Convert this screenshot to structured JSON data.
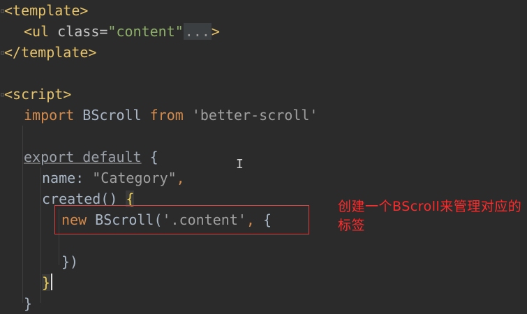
{
  "editor": {
    "lines": [
      {
        "id": "l1",
        "parts": [
          {
            "cls": "tag",
            "t": "<template>"
          }
        ]
      },
      {
        "id": "l2",
        "parts": [
          {
            "cls": "tag",
            "t": "<ul "
          },
          {
            "cls": "attr",
            "t": "class="
          },
          {
            "cls": "str",
            "t": "\"content\""
          },
          {
            "cls": "fold-ellipsis",
            "t": "..."
          },
          {
            "cls": "tag",
            "t": ">"
          }
        ]
      },
      {
        "id": "l3",
        "parts": [
          {
            "cls": "tag",
            "t": "</template>"
          }
        ]
      },
      {
        "id": "l4",
        "parts": []
      },
      {
        "id": "l5",
        "parts": [
          {
            "cls": "tag",
            "t": "<script>"
          }
        ]
      },
      {
        "id": "l6",
        "parts": [
          {
            "cls": "kw",
            "t": "import"
          },
          {
            "cls": "prop",
            "t": " BScroll "
          },
          {
            "cls": "kw",
            "t": "from"
          },
          {
            "cls": "str-gray",
            "t": " 'better-scroll'"
          }
        ]
      },
      {
        "id": "l7",
        "parts": []
      },
      {
        "id": "l8",
        "parts": [
          {
            "cls": "kw-gray",
            "t": "export default"
          },
          {
            "cls": "prop",
            "t": " {"
          }
        ]
      },
      {
        "id": "l9",
        "parts": [
          {
            "cls": "prop",
            "t": "name: "
          },
          {
            "cls": "str-gray",
            "t": "\"Category\""
          },
          {
            "cls": "kw",
            "t": ","
          }
        ]
      },
      {
        "id": "l10",
        "parts": [
          {
            "cls": "prop",
            "t": "created() "
          },
          {
            "cls": "brace-hl",
            "t": "{"
          }
        ]
      },
      {
        "id": "l11",
        "parts": [
          {
            "cls": "kw",
            "t": "new"
          },
          {
            "cls": "prop",
            "t": " BScroll("
          },
          {
            "cls": "str-gray",
            "t": "'.content'"
          },
          {
            "cls": "kw",
            "t": ","
          },
          {
            "cls": "prop",
            "t": " {"
          }
        ]
      },
      {
        "id": "l12",
        "parts": []
      },
      {
        "id": "l13",
        "parts": [
          {
            "cls": "prop",
            "t": "})"
          }
        ]
      },
      {
        "id": "l14",
        "parts": [
          {
            "cls": "brace-hl",
            "t": "}"
          }
        ]
      },
      {
        "id": "l15",
        "parts": [
          {
            "cls": "prop",
            "t": "}"
          }
        ]
      }
    ]
  },
  "annotation": {
    "text": "创建一个BScroll来管理对应的标签",
    "color": "#ff2a2a"
  },
  "colors": {
    "background": "#2b2b2b",
    "tag": "#e6c36a",
    "keyword": "#d48a4a",
    "string": "#8fb06a",
    "highlight_box": "#d94040"
  }
}
